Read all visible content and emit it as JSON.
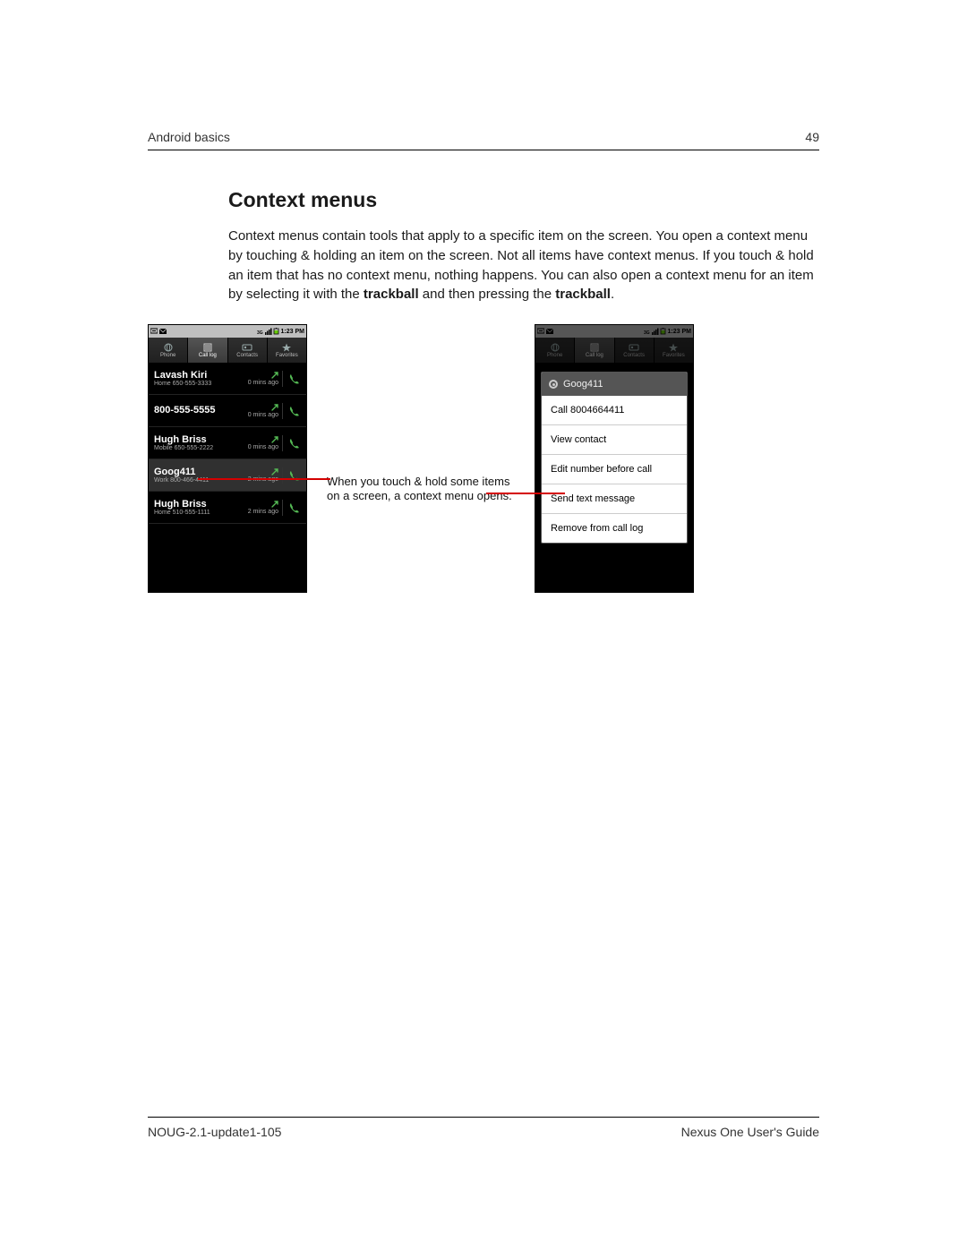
{
  "header": {
    "left": "Android basics",
    "right": "49"
  },
  "title": "Context menus",
  "paragraph_html": "Context menus contain tools that apply to a specific item on the screen. You open a context menu by touching & holding an item on the screen. Not all items have context menus. If you touch & hold an item that has no context menu, nothing happens. You can also open a context menu for an item by selecting it with the <b>trackball</b> and then pressing the <b>trackball</b>.",
  "status_time": "1:23 PM",
  "tabs": [
    {
      "label": "Phone",
      "icon": "globe"
    },
    {
      "label": "Call log",
      "icon": "list",
      "active": true
    },
    {
      "label": "Contacts",
      "icon": "card"
    },
    {
      "label": "Favorites",
      "icon": "star"
    }
  ],
  "call_log": [
    {
      "name": "Lavash Kiri",
      "sub": "Home  650-555-3333",
      "time": "0 mins ago"
    },
    {
      "name": "800-555-5555",
      "sub": "",
      "time": "0 mins ago"
    },
    {
      "name": "Hugh Briss",
      "sub": "Mobile  650-555-2222",
      "time": "0 mins ago"
    },
    {
      "name": "Goog411",
      "sub": "Work  800-466-4411",
      "time": "2 mins ago",
      "selected": true
    },
    {
      "name": "Hugh Briss",
      "sub": "Home  510-555-1111",
      "time": "2 mins ago"
    }
  ],
  "context_menu": {
    "title": "Goog411",
    "items": [
      "Call 8004664411",
      "View contact",
      "Edit number before call",
      "Send text message",
      "Remove from call log"
    ]
  },
  "callout": "When you touch & hold some items\non a screen, a context menu opens.",
  "footer": {
    "left": "NOUG-2.1-update1-105",
    "right": "Nexus One User's Guide"
  }
}
